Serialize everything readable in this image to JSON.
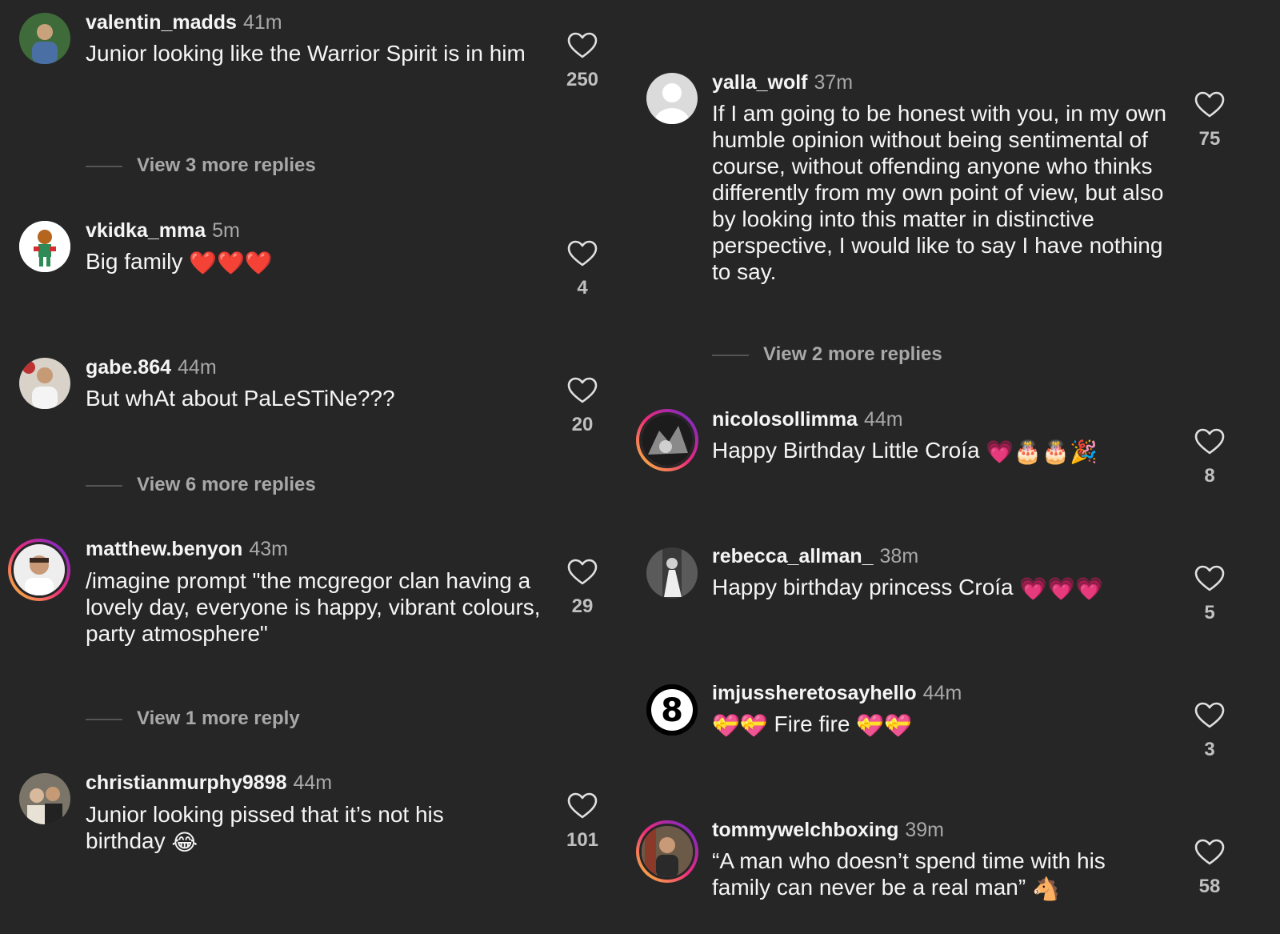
{
  "left_column": [
    {
      "username": "valentin_madds",
      "time": "41m",
      "text": "Junior looking like the Warrior Spirit is in him",
      "likes": "250",
      "replies": "View 3 more replies"
    },
    {
      "username": "vkidka_mma",
      "time": "5m",
      "text": "Big family",
      "emojis": "❤️❤️❤️",
      "likes": "4"
    },
    {
      "username": "gabe.864",
      "time": "44m",
      "text": "But whAt about PaLeSTiNe???",
      "likes": "20",
      "replies": "View 6 more replies"
    },
    {
      "username": "matthew.benyon",
      "time": "43m",
      "text": "/imagine prompt \"the mcgregor clan having a lovely day, everyone is happy, vibrant colours, party atmosphere\"",
      "likes": "29",
      "replies": "View 1 more reply"
    },
    {
      "username": "christianmurphy9898",
      "time": "44m",
      "text": "Junior looking pissed that it’s not his birthday",
      "emojis": "😂",
      "likes": "101"
    }
  ],
  "right_column": [
    {
      "username": "yalla_wolf",
      "time": "37m",
      "text": "If I am going to be honest with you, in my own humble opinion without being sentimental of course, without offending anyone who thinks differently from my own point of view, but also by looking into this matter in distinctive perspective, I would like to say I have nothing to say.",
      "likes": "75",
      "replies": "View 2 more replies"
    },
    {
      "username": "nicolosollimma",
      "time": "44m",
      "text": "Happy Birthday Little Croía",
      "emojis": "💗🎂🎂🎉",
      "likes": "8"
    },
    {
      "username": "rebecca_allman_",
      "time": "38m",
      "text": "Happy birthday princess Croía",
      "emojis": "💗💗💗",
      "likes": "5"
    },
    {
      "username": "imjussheretosayhello",
      "time": "44m",
      "text_prefix_emojis": "💝💝",
      "text": "Fire fire",
      "emojis": "💝💝",
      "likes": "3",
      "avatar_label": "8"
    },
    {
      "username": "tommywelchboxing",
      "time": "39m",
      "text": "“A man who doesn’t spend time with his family can never be a real man”",
      "emojis": "🐴",
      "likes": "58"
    }
  ],
  "colors": {
    "background": "#262626",
    "text": "#f5f5f5",
    "muted": "#a8a8a8",
    "story_ring_start": "#f9ce34",
    "story_ring_mid": "#ee2a7b",
    "story_ring_end": "#6228d7"
  },
  "icons": {
    "like": "heart-outline-icon"
  }
}
